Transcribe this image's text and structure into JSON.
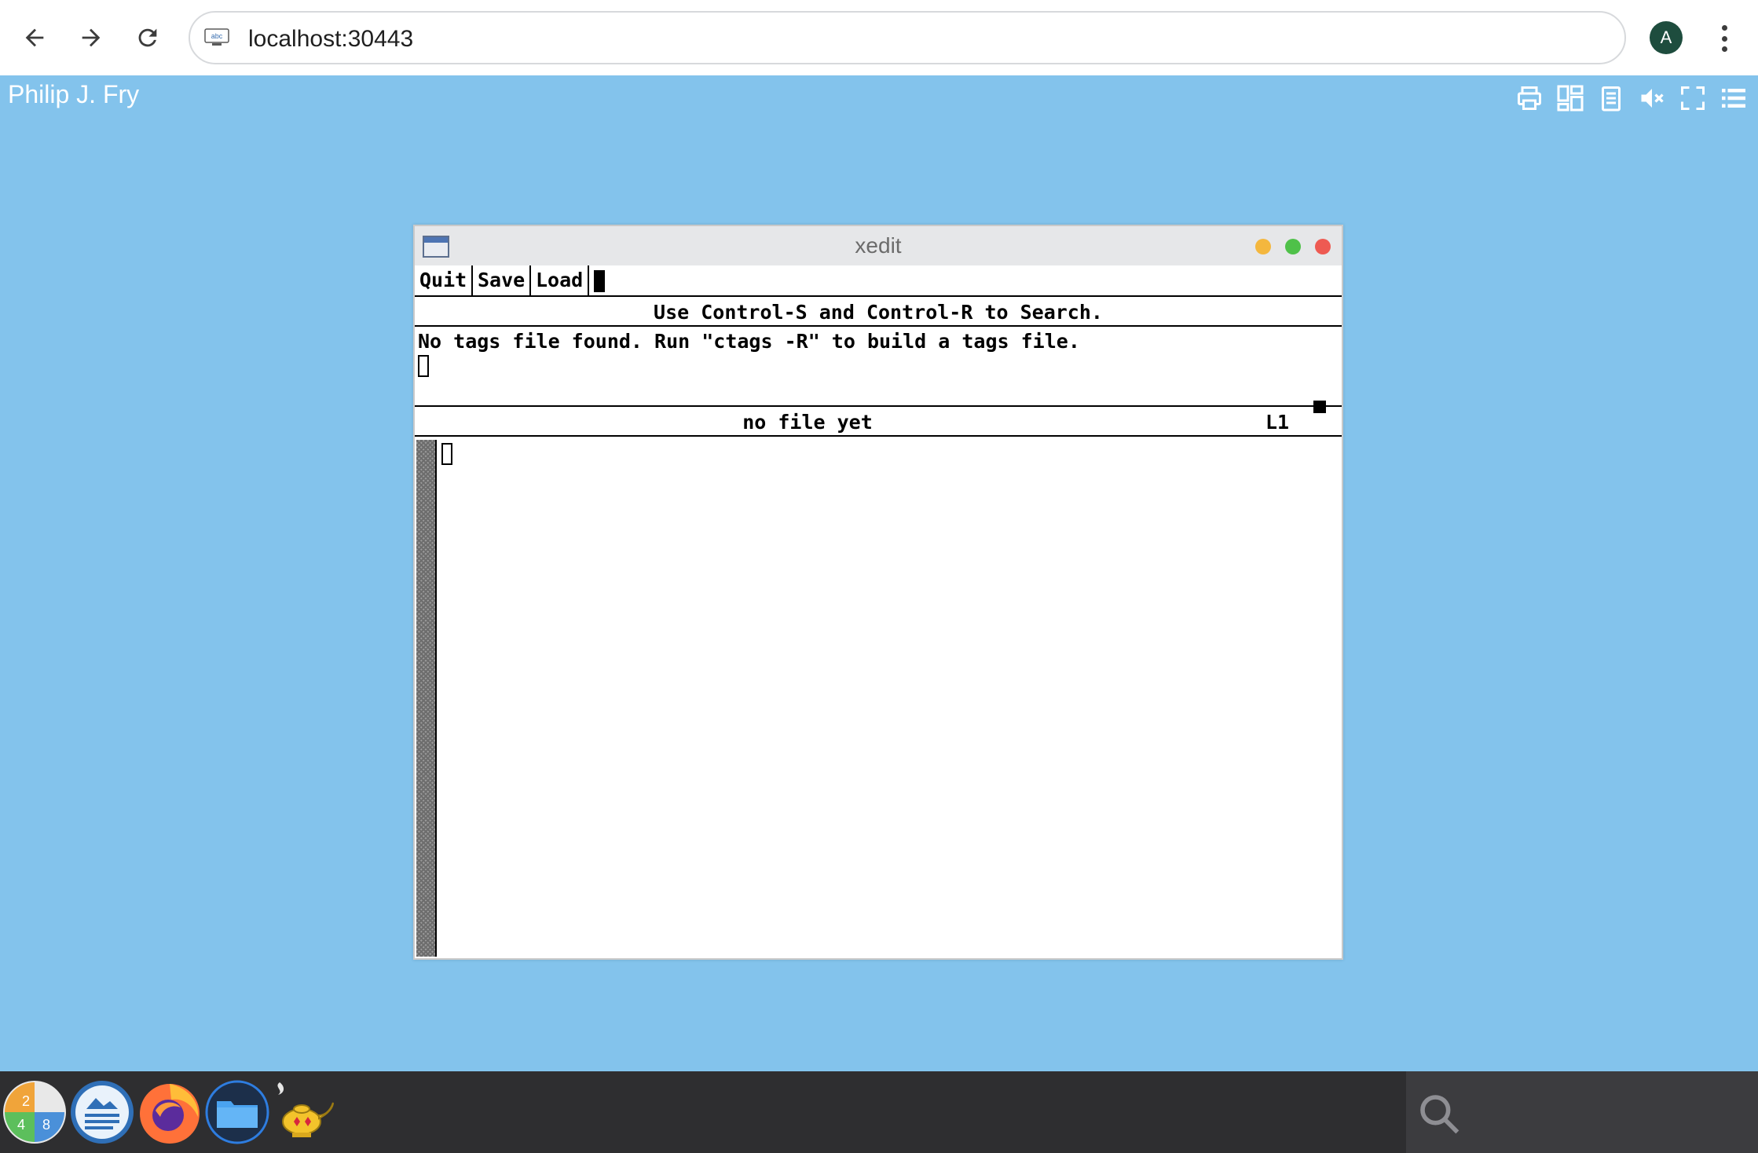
{
  "browser": {
    "url": "localhost:30443",
    "site_icon_text": "abc",
    "profile_initial": "A"
  },
  "desktop": {
    "user_name": "Philip J. Fry",
    "tray_icons": [
      "printer-icon",
      "layout-icon",
      "clipboard-icon",
      "mute-icon",
      "fullscreen-icon",
      "menu-list-icon"
    ],
    "background_color": "#83c3ec"
  },
  "xedit": {
    "title": "xedit",
    "buttons": {
      "quit": "Quit",
      "save": "Save",
      "load": "Load"
    },
    "info_line": "Use Control-S and Control-R to Search.",
    "message": "No tags file found. Run \"ctags -R\" to build a tags file.",
    "status_file": "no file yet",
    "status_line": "L1",
    "window_controls": {
      "minimize_color": "#f4b73e",
      "maximize_color": "#4fc149",
      "close_color": "#ee5a52"
    }
  },
  "taskbar": {
    "apps": [
      "numbers-app-icon",
      "text-editor-app-icon",
      "firefox-icon",
      "file-manager-icon",
      "genie-lamp-icon"
    ],
    "numbers_labels": [
      "2",
      "4",
      "8"
    ],
    "search_icon": "search-icon"
  }
}
